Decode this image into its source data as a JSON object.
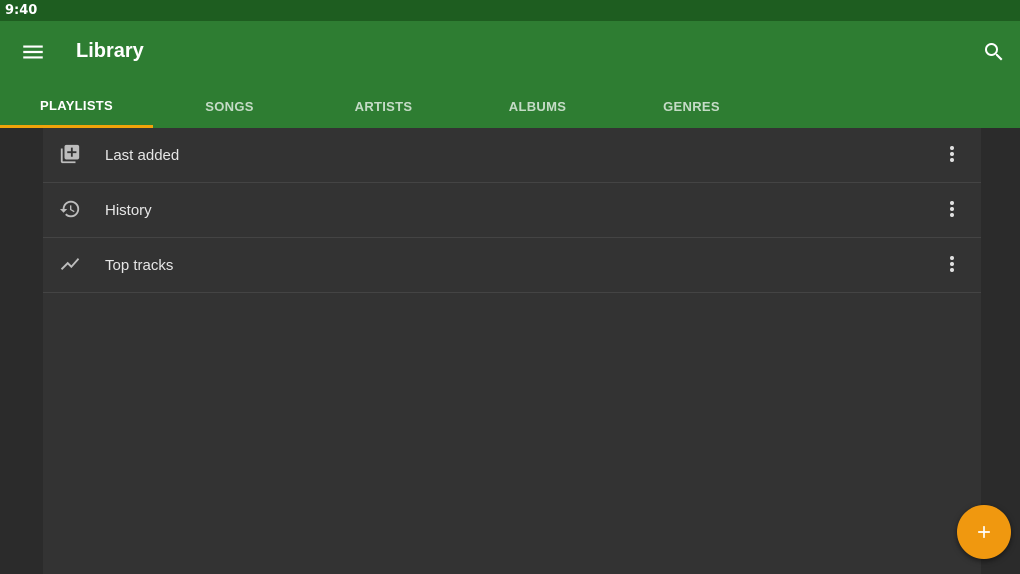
{
  "status_bar": {
    "time": "9:40"
  },
  "app_bar": {
    "title": "Library",
    "menu_icon": "menu-icon",
    "search_icon": "search-icon"
  },
  "tabs": [
    {
      "label": "PLAYLISTS",
      "active": true
    },
    {
      "label": "SONGS",
      "active": false
    },
    {
      "label": "ARTISTS",
      "active": false
    },
    {
      "label": "ALBUMS",
      "active": false
    },
    {
      "label": "GENRES",
      "active": false
    }
  ],
  "playlists": [
    {
      "label": "Last added",
      "icon": "playlist-add-icon"
    },
    {
      "label": "History",
      "icon": "history-icon"
    },
    {
      "label": "Top tracks",
      "icon": "trending-up-icon"
    }
  ],
  "fab": {
    "icon": "add-icon"
  },
  "colors": {
    "status_bar": "#1e5d20",
    "app_bar": "#2e7d32",
    "tab_indicator": "#f0a30a",
    "fab": "#f0980f",
    "background": "#2b2b2b",
    "list_background": "#333333"
  }
}
